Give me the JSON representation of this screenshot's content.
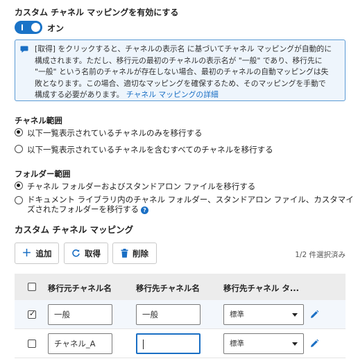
{
  "custom_mapping": {
    "title": "カスタム チャネル マッピングを有効にする",
    "toggle_state": "オン",
    "info_lines": [
      "[取得] をクリックすると、チャネルの表示名 に基づいてチャネル マッピングが自動的に",
      "構成されます。ただし、移行元の最初のチャネルの表示名が \"一般\" であり、移行先に",
      "\"一般\" という名前のチャネルが存在しない場合、最初のチャネルの自動マッピングは失",
      "敗となります。この場合、適切なマッピングを確保するため、そのマッピングを手動で",
      "構成する必要があります。"
    ],
    "info_link": "チャネル マッピングの詳細"
  },
  "channel_scope": {
    "title": "チャネル範囲",
    "options": [
      "以下一覧表示されているチャネルのみを移行する",
      "以下一覧表示されているチャネルを含むすべてのチャネルを移行する"
    ],
    "selected": 0
  },
  "folder_scope": {
    "title": "フォルダー範囲",
    "options": [
      "チャネル フォルダーおよびスタンドアロン ファイルを移行する",
      "ドキュメント ライブラリ内のチャネル フォルダー、スタンドアロン ファイル、カスタマイ",
      "ズされたフォルダーを移行する"
    ],
    "selected": 0,
    "help_glyph": "?"
  },
  "mapping": {
    "title": "カスタム チャネル マッピング",
    "toolbar": {
      "add_label": "追加",
      "retrieve_label": "取得",
      "delete_label": "削除",
      "selection_status": "1/2 件選択済み"
    },
    "columns": [
      "移行元チャネル名",
      "移行先チャネル名",
      "移行先チャネル タ..."
    ],
    "rows": [
      {
        "checked": true,
        "source": "一般",
        "target": "一般",
        "type": "標準"
      },
      {
        "checked": false,
        "source": "チャネル_A",
        "target": "",
        "type": "標準"
      }
    ]
  },
  "colors": {
    "accent": "#1a73c7",
    "info_background": "#eef5fc",
    "info_border": "#5b9bd5",
    "header_background": "#ececec"
  },
  "icons": {
    "toggle": "toggle-switch",
    "info": "speech-bubble-icon",
    "add": "plus-icon",
    "retrieve": "refresh-icon",
    "delete": "trash-icon",
    "edit": "pencil-icon"
  }
}
